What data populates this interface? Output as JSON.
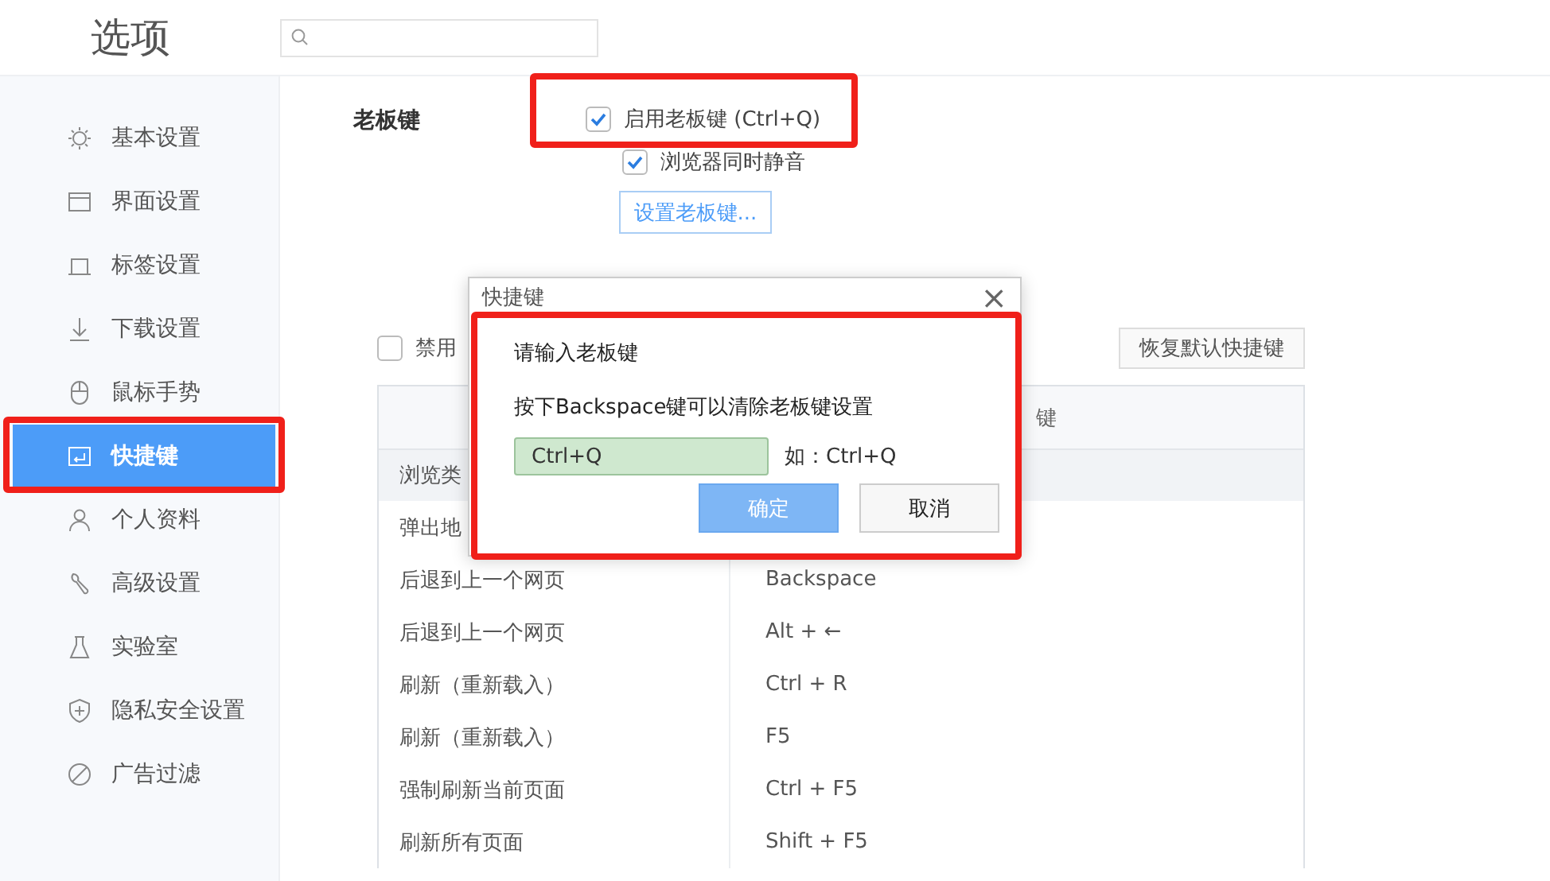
{
  "window": {
    "title": "选项"
  },
  "sidebar": {
    "items": [
      {
        "label": "基本设置",
        "selected": false
      },
      {
        "label": "界面设置",
        "selected": false
      },
      {
        "label": "标签设置",
        "selected": false
      },
      {
        "label": "下载设置",
        "selected": false
      },
      {
        "label": "鼠标手势",
        "selected": false
      },
      {
        "label": "快捷键",
        "selected": true
      },
      {
        "label": "个人资料",
        "selected": false
      },
      {
        "label": "高级设置",
        "selected": false
      },
      {
        "label": "实验室",
        "selected": false
      },
      {
        "label": "隐私安全设置",
        "selected": false
      },
      {
        "label": "广告过滤",
        "selected": false
      }
    ]
  },
  "boss_key": {
    "label": "老板键",
    "options": [
      {
        "label": "启用老板键 (Ctrl+Q)",
        "checked": true
      },
      {
        "label": "浏览器同时静音",
        "checked": true
      }
    ],
    "button": "设置老板键..."
  },
  "shortcuts": {
    "disable_all": {
      "label": "禁用",
      "checked": false
    },
    "restore_button": "恢复默认快捷键",
    "column_2_header": "键",
    "group": "浏览类",
    "rows": [
      {
        "action": "弹出地"
      },
      {
        "action": "后退到上一个网页",
        "keys": "Backspace"
      },
      {
        "action": "后退到上一个网页",
        "keys": "Alt + ←"
      },
      {
        "action": "刷新（重新载入）",
        "keys": "Ctrl + R"
      },
      {
        "action": "刷新（重新载入）",
        "keys": "F5"
      },
      {
        "action": "强制刷新当前页面",
        "keys": "Ctrl + F5"
      },
      {
        "action": "刷新所有页面",
        "keys": "Shift + F5"
      }
    ]
  },
  "dialog": {
    "title": "快捷键",
    "close": "×",
    "prompt": "请输入老板键",
    "hint": "按下Backspace键可以清除老板键设置",
    "input": {
      "value": "Ctrl+Q"
    },
    "example": "如：Ctrl+Q",
    "buttons": [
      {
        "label": "确定",
        "kind": "primary"
      },
      {
        "label": "取消",
        "kind": "secondary"
      }
    ]
  }
}
